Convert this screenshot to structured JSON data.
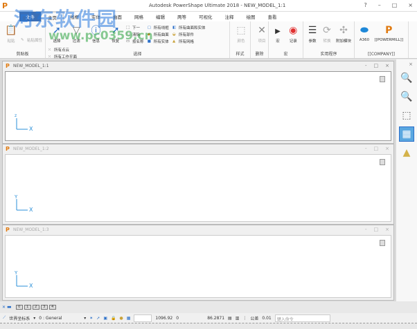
{
  "window": {
    "title": "Autodesk PowerShape Ultimate 2018 - NEW_MODEL_1:1",
    "help": "?",
    "minimize": "–",
    "maximize": "□",
    "close": "×"
  },
  "tabs": [
    "文件",
    "主页",
    "线框",
    "实体",
    "曲面",
    "网格",
    "编辑",
    "两等",
    "可视化",
    "注释",
    "绘图",
    "查看"
  ],
  "ribbon": {
    "clipboard": {
      "label": "剪贴板",
      "items": [
        "粘贴",
        "粘贴属性"
      ]
    },
    "select": {
      "label": "选择",
      "big": [
        "选择",
        "过滤",
        "信息",
        "恢复"
      ],
      "small": [
        "下一",
        "清除",
        "按名称"
      ],
      "all1": [
        "所有线框",
        "所有曲面",
        "所有实体"
      ],
      "all2": [
        "所有曲面和实体",
        "所有部件",
        "所有网格"
      ],
      "all3": [
        "所有点云",
        "所有工作平面",
        "所有"
      ]
    },
    "style": {
      "label": "样式",
      "items": [
        "颜色"
      ]
    },
    "delete": {
      "label": "删除",
      "items": [
        "项目"
      ]
    },
    "macro": {
      "label": "宏",
      "items": [
        "宏",
        "记录"
      ]
    },
    "utils": {
      "label": "实用程序",
      "items": [
        "参数",
        "转换",
        "附加模块"
      ]
    },
    "company": {
      "label": "[[COMPANY]]",
      "items": [
        "A360",
        "[[POWERMILL]]"
      ]
    }
  },
  "viewports": [
    {
      "name": "NEW_MODEL_1:1"
    },
    {
      "name": "NEW_MODEL_1:2"
    },
    {
      "name": "NEW_MODEL_1:3"
    }
  ],
  "axes": {
    "x": "X",
    "y": "Y"
  },
  "view_tabs": [
    "0",
    "1",
    "2",
    "3",
    "4"
  ],
  "status": {
    "coord_system": "世界坐标系",
    "level": "0  : General",
    "x": "1096.92",
    "y": "0",
    "z": "86.2871",
    "tolerance_label": "公差",
    "tolerance": "0.01",
    "command_placeholder": "键入命令"
  },
  "watermark": {
    "text": "河东软件园",
    "url": "www.pc0359.cn"
  }
}
